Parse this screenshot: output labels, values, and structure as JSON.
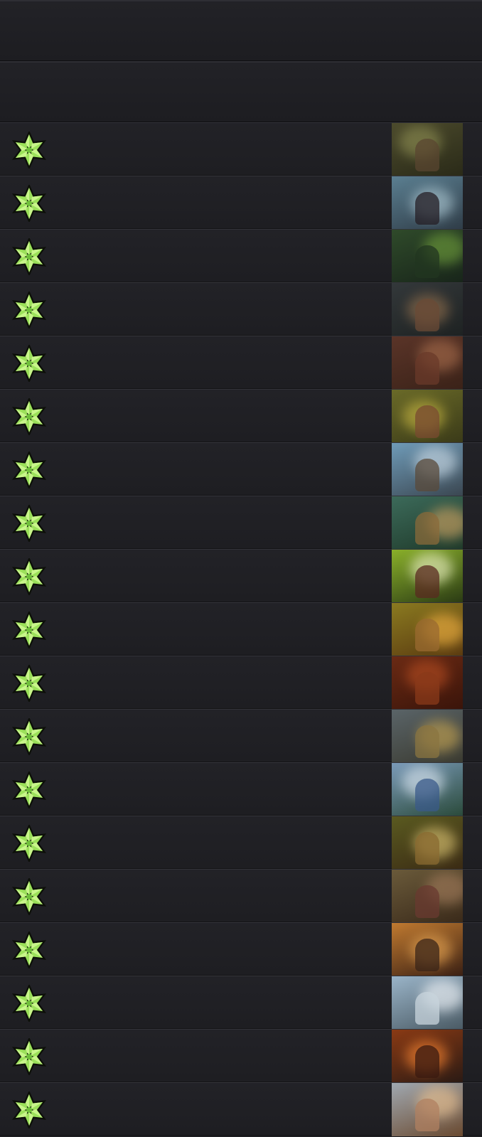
{
  "list": {
    "header_rows": [
      "",
      ""
    ],
    "rows": [
      {
        "label": "",
        "icon": "leaf-star-icon",
        "art": {
          "top": "#4b4a2c",
          "bottom": "#2a2a18",
          "glow": "#8a8a50",
          "figure": "#5a4630"
        }
      },
      {
        "label": "",
        "icon": "leaf-star-icon",
        "art": {
          "top": "#5b7f91",
          "bottom": "#2f3c47",
          "glow": "#a9c4cf",
          "figure": "#241e24"
        }
      },
      {
        "label": "",
        "icon": "leaf-star-icon",
        "art": {
          "top": "#2f4a2a",
          "bottom": "#18251a",
          "glow": "#6c9a3a",
          "figure": "#223520"
        }
      },
      {
        "label": "",
        "icon": "leaf-star-icon",
        "art": {
          "top": "#33383a",
          "bottom": "#1e2222",
          "glow": "#8a6a4a",
          "figure": "#6a4a36"
        }
      },
      {
        "label": "",
        "icon": "leaf-star-icon",
        "art": {
          "top": "#5a3428",
          "bottom": "#3a2218",
          "glow": "#a46a4a",
          "figure": "#6a3a2a"
        }
      },
      {
        "label": "",
        "icon": "leaf-star-icon",
        "art": {
          "top": "#6a6a28",
          "bottom": "#3a3a18",
          "glow": "#c0b040",
          "figure": "#7a4a30"
        }
      },
      {
        "label": "",
        "icon": "leaf-star-icon",
        "art": {
          "top": "#6f9bb8",
          "bottom": "#3a4650",
          "glow": "#c8d8e4",
          "figure": "#5a4a3a"
        }
      },
      {
        "label": "",
        "icon": "leaf-star-icon",
        "art": {
          "top": "#3c6a5a",
          "bottom": "#1f3a2a",
          "glow": "#caa060",
          "figure": "#8a6a3a"
        }
      },
      {
        "label": "",
        "icon": "leaf-star-icon",
        "art": {
          "top": "#8ab02a",
          "bottom": "#2a3a14",
          "glow": "#eaf0c0",
          "figure": "#5a2a20"
        }
      },
      {
        "label": "",
        "icon": "leaf-star-icon",
        "art": {
          "top": "#8a7a20",
          "bottom": "#5a3a10",
          "glow": "#f0b040",
          "figure": "#9a6a30"
        }
      },
      {
        "label": "",
        "icon": "leaf-star-icon",
        "art": {
          "top": "#6a2a14",
          "bottom": "#3a140a",
          "glow": "#b04a20",
          "figure": "#8a3a1a"
        }
      },
      {
        "label": "",
        "icon": "leaf-star-icon",
        "art": {
          "top": "#5a6468",
          "bottom": "#3a3a30",
          "glow": "#c0a050",
          "figure": "#8a7440"
        }
      },
      {
        "label": "",
        "icon": "leaf-star-icon",
        "art": {
          "top": "#7a9ab8",
          "bottom": "#2a4a3a",
          "glow": "#d8e4f0",
          "figure": "#3a5a8a"
        }
      },
      {
        "label": "",
        "icon": "leaf-star-icon",
        "art": {
          "top": "#5a5a20",
          "bottom": "#3a2a14",
          "glow": "#d8c070",
          "figure": "#8a6a30"
        }
      },
      {
        "label": "",
        "icon": "leaf-star-icon",
        "art": {
          "top": "#6a5a3a",
          "bottom": "#3a2a1a",
          "glow": "#a07a5a",
          "figure": "#6a3a30"
        }
      },
      {
        "label": "",
        "icon": "leaf-star-icon",
        "art": {
          "top": "#c07a30",
          "bottom": "#3a2014",
          "glow": "#e0a050",
          "figure": "#3a2418"
        }
      },
      {
        "label": "",
        "icon": "leaf-star-icon",
        "art": {
          "top": "#9ab4c8",
          "bottom": "#4a5a64",
          "glow": "#f0f4f8",
          "figure": "#c8d4dc"
        }
      },
      {
        "label": "",
        "icon": "leaf-star-icon",
        "art": {
          "top": "#8a3a14",
          "bottom": "#2a1a14",
          "glow": "#f08030",
          "figure": "#3a1a10"
        }
      },
      {
        "label": "",
        "icon": "leaf-star-icon",
        "art": {
          "top": "#a0a8b0",
          "bottom": "#6a4a30",
          "glow": "#e8c090",
          "figure": "#b08060"
        }
      }
    ]
  }
}
